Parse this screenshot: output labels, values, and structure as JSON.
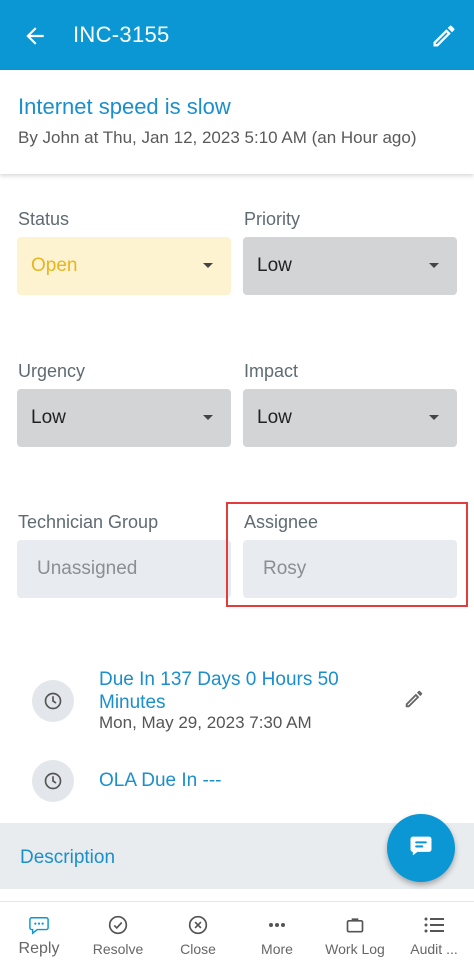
{
  "appbar": {
    "ticket_id": "INC-3155"
  },
  "header": {
    "subject": "Internet speed is slow",
    "byline": "By John at Thu, Jan 12, 2023 5:10 AM (an Hour ago)"
  },
  "fields": {
    "status": {
      "label": "Status",
      "value": "Open"
    },
    "priority": {
      "label": "Priority",
      "value": "Low"
    },
    "urgency": {
      "label": "Urgency",
      "value": "Low"
    },
    "impact": {
      "label": "Impact",
      "value": "Low"
    },
    "technician_group": {
      "label": "Technician Group",
      "value": "Unassigned"
    },
    "assignee": {
      "label": "Assignee",
      "value": "Rosy"
    }
  },
  "due": {
    "title": "Due In 137 Days 0 Hours 50 Minutes",
    "date": "Mon, May 29, 2023 7:30 AM"
  },
  "ola": {
    "title": "OLA Due In ---"
  },
  "description": {
    "label": "Description"
  },
  "bottom_nav": {
    "reply": "Reply",
    "resolve": "Resolve",
    "close": "Close",
    "more": "More",
    "work_log": "Work Log",
    "audit": "Audit ..."
  },
  "colors": {
    "primary": "#0a97d4",
    "status_open_bg": "#fdf3d0",
    "status_open_text": "#e8b51f",
    "highlight": "#e23c3c"
  },
  "icons": [
    "back-arrow-icon",
    "edit-pencil-icon",
    "caret-down-icon",
    "clock-icon",
    "pencil-icon",
    "chat-bubble-icon",
    "reply-icon",
    "resolve-check-icon",
    "close-x-icon",
    "more-dots-icon",
    "briefcase-icon",
    "list-icon"
  ]
}
